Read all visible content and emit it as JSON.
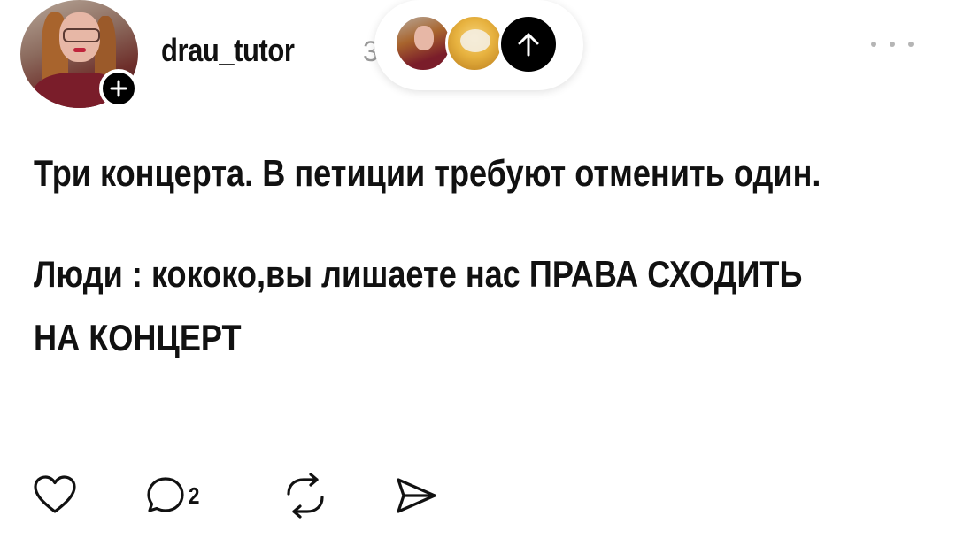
{
  "post": {
    "username": "drau_tutor",
    "timestamp": "3",
    "text_line1": "Три концерта. В петиции требуют отменить один.",
    "text_line2": "Люди : кококо,вы лишаете нас ПРАВА СХОДИТЬ НА КОНЦЕРТ",
    "reply_count": "2"
  },
  "icons": {
    "follow": "plus-icon",
    "scroll_top": "arrow-up-icon",
    "more": "more-dots-icon",
    "like": "heart-icon",
    "reply": "comment-icon",
    "repost": "repost-icon",
    "share": "send-icon"
  },
  "colors": {
    "text": "#111111",
    "muted": "#999999",
    "accent": "#000000",
    "background": "#ffffff"
  }
}
